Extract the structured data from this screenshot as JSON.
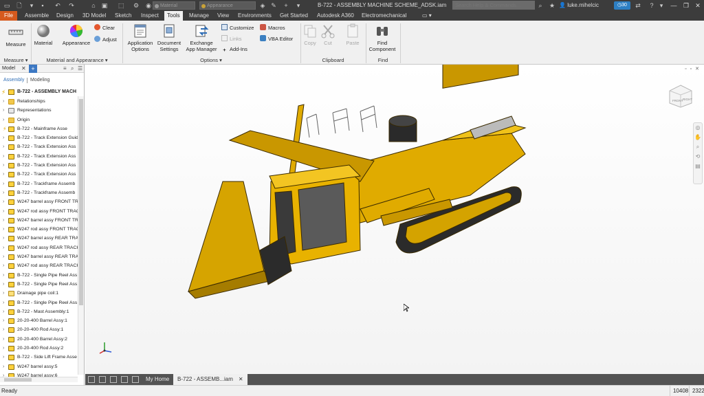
{
  "titlebar": {
    "material_dropdown": "Material",
    "appearance_dropdown": "Appearance",
    "document_title": "B-722 - ASSEMBLY MACHINE SCHEME_ADSK.iam",
    "search_placeholder": "Search Help & Commands...",
    "user_name": "luke.mihelcic",
    "clock_count": "30"
  },
  "tabs": [
    {
      "label": "File"
    },
    {
      "label": "Assemble"
    },
    {
      "label": "Design"
    },
    {
      "label": "3D Model"
    },
    {
      "label": "Sketch"
    },
    {
      "label": "Inspect"
    },
    {
      "label": "Tools"
    },
    {
      "label": "Manage"
    },
    {
      "label": "View"
    },
    {
      "label": "Environments"
    },
    {
      "label": "Get Started"
    },
    {
      "label": "Autodesk A360"
    },
    {
      "label": "Electromechanical"
    }
  ],
  "ribbon": {
    "measure": "Measure",
    "material": "Material",
    "appearance": "Appearance",
    "clear": "Clear",
    "adjust": "Adjust",
    "application_options_1": "Application",
    "application_options_2": "Options",
    "document_settings_1": "Document",
    "document_settings_2": "Settings",
    "exchange_1": "Exchange",
    "exchange_2": "App Manager",
    "customize": "Customize",
    "links": "Links",
    "add_ins": "Add-Ins",
    "macros": "Macros",
    "vba_editor": "VBA Editor",
    "copy": "Copy",
    "cut": "Cut",
    "paste": "Paste",
    "find_component_1": "Find",
    "find_component_2": "Component",
    "groups": {
      "measure": "Measure",
      "material_appearance": "Material and Appearance",
      "options": "Options",
      "clipboard": "Clipboard",
      "find": "Find"
    }
  },
  "browser": {
    "title": "Model",
    "mode_assembly": "Assembly",
    "mode_modeling": "Modeling",
    "root": "B-722 - ASSEMBLY MACH",
    "nodes": [
      {
        "label": "Relationships",
        "icon": "folder"
      },
      {
        "label": "Representations",
        "icon": "rep"
      },
      {
        "label": "Origin",
        "icon": "folder"
      },
      {
        "label": "B-722 - Mainframe Asse",
        "icon": "asm"
      },
      {
        "label": "B-722 - Track Extension Guid",
        "icon": "asm"
      },
      {
        "label": "B-722 - Track Extension Ass",
        "icon": "asm"
      },
      {
        "label": "B-722 - Track Extension Ass",
        "icon": "asm"
      },
      {
        "label": "B-722 - Track Extension Ass",
        "icon": "asm"
      },
      {
        "label": "B-722 - Track Extension Ass",
        "icon": "asm"
      },
      {
        "label": "B-722 - Trackframe Assemb",
        "icon": "asm"
      },
      {
        "label": "B-722 - Trackframe Assemb",
        "icon": "asm"
      },
      {
        "label": "W247 barrel assy FRONT TR",
        "icon": "asm"
      },
      {
        "label": "W247 rod assy FRONT TRAC",
        "icon": "asm"
      },
      {
        "label": "W247 barrel assy FRONT TR",
        "icon": "asm"
      },
      {
        "label": "W247 rod assy FRONT TRAC",
        "icon": "asm"
      },
      {
        "label": "W247 barrel assy REAR TRA",
        "icon": "asm"
      },
      {
        "label": "W247 rod assy REAR TRACK",
        "icon": "asm"
      },
      {
        "label": "W247 barrel assy REAR TRA",
        "icon": "asm"
      },
      {
        "label": "W247 rod assy REAR TRACK",
        "icon": "asm"
      },
      {
        "label": "B-722 - Single Pipe Reel Ass",
        "icon": "asm"
      },
      {
        "label": "B-722 - Single Pipe Reel Ass",
        "icon": "asm"
      },
      {
        "label": "Drainage pipe coil:1",
        "icon": "part"
      },
      {
        "label": "B-722 - Single Pipe Reel Ass",
        "icon": "asm"
      },
      {
        "label": "B-722 - Mast Assembly:1",
        "icon": "asm"
      },
      {
        "label": "20-20-400 Barrel Assy:1",
        "icon": "asm"
      },
      {
        "label": "20-20-400 Rod Assy:1",
        "icon": "asm"
      },
      {
        "label": "20-20-400 Barrel Assy:2",
        "icon": "asm"
      },
      {
        "label": "20-20-400 Rod Assy:2",
        "icon": "asm"
      },
      {
        "label": "B-722 - Side Lift Frame Asse",
        "icon": "asm"
      },
      {
        "label": "W247 barrel assy:5",
        "icon": "asm"
      },
      {
        "label": "W247 barrel assy:6",
        "icon": "asm"
      }
    ]
  },
  "viewcube": {
    "front": "FRONT",
    "right": "RIGHT"
  },
  "doc_tabs": {
    "home": "My Home",
    "active": "B-722 - ASSEMB...iam"
  },
  "status": {
    "ready": "Ready",
    "count1": "10408",
    "count2": "2322"
  },
  "colors": {
    "accent_file": "#d65a1e",
    "machine_yellow": "#e8b200",
    "title_bar": "#3c3c3c"
  }
}
